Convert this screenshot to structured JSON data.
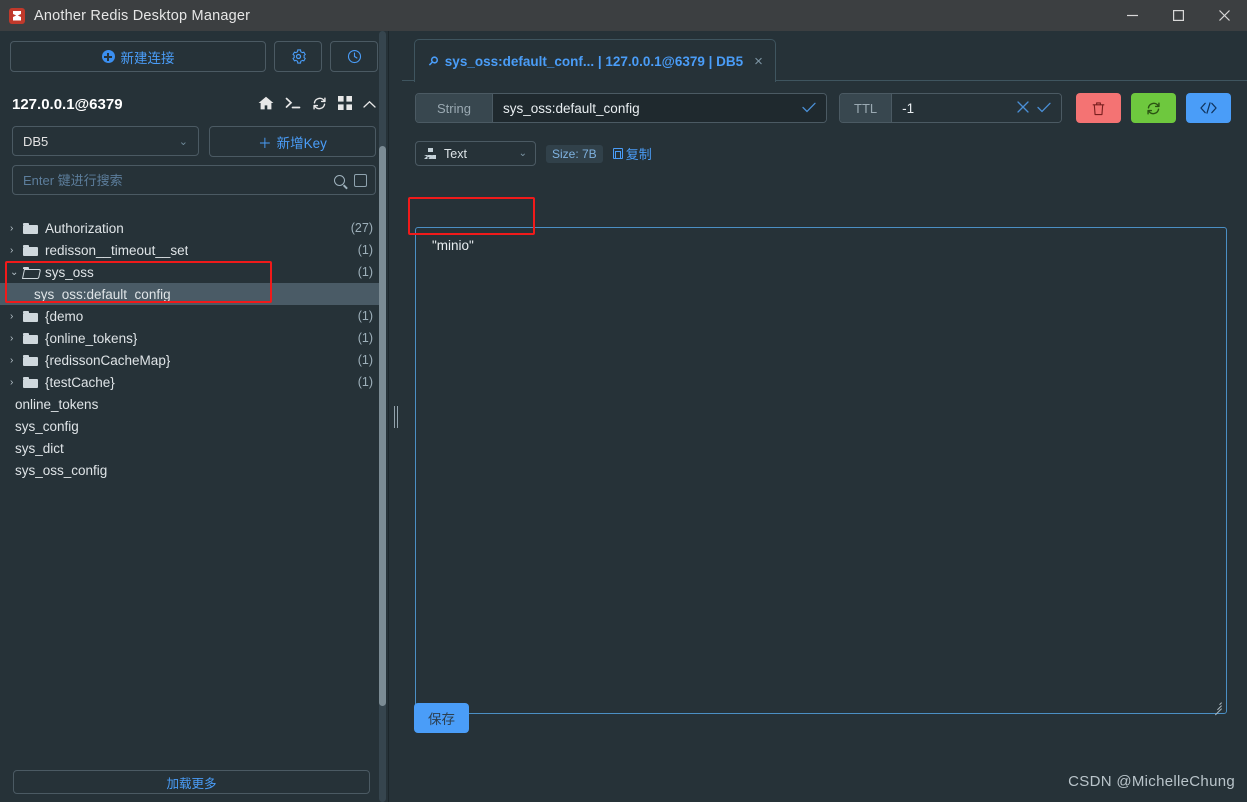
{
  "window": {
    "title": "Another Redis Desktop Manager",
    "app_icon": "redis-logo-icon",
    "minimize": "—",
    "maximize": "▫",
    "close": "✕"
  },
  "sidebar": {
    "new_connection_label": "新建连接",
    "settings_icon": "gear-icon",
    "history_icon": "clock-icon",
    "host": "127.0.0.1@6379",
    "host_icons": [
      "home-icon",
      "console-icon",
      "refresh-icon",
      "grid-icon",
      "collapse-icon"
    ],
    "db_selected": "DB5",
    "add_key_label": "新增Key",
    "search_placeholder": "Enter 键进行搜索",
    "search_value": "",
    "load_more_label": "加载更多",
    "tree": [
      {
        "label": "Authorization",
        "count": "(27)",
        "type": "folder",
        "arrow": "›",
        "selected": false
      },
      {
        "label": "redisson__timeout__set",
        "count": "(1)",
        "type": "folder",
        "arrow": "›",
        "selected": false
      },
      {
        "label": "sys_oss",
        "count": "(1)",
        "type": "folder-open",
        "arrow": "⌄",
        "selected": false
      },
      {
        "label": "sys_oss:default_config",
        "count": "",
        "type": "key",
        "arrow": "",
        "selected": true
      },
      {
        "label": "{demo",
        "count": "(1)",
        "type": "folder",
        "arrow": "›",
        "selected": false
      },
      {
        "label": "{online_tokens}",
        "count": "(1)",
        "type": "folder",
        "arrow": "›",
        "selected": false
      },
      {
        "label": "{redissonCacheMap}",
        "count": "(1)",
        "type": "folder",
        "arrow": "›",
        "selected": false
      },
      {
        "label": "{testCache}",
        "count": "(1)",
        "type": "folder",
        "arrow": "›",
        "selected": false
      },
      {
        "label": "online_tokens",
        "count": "",
        "type": "plain",
        "arrow": "",
        "selected": false
      },
      {
        "label": "sys_config",
        "count": "",
        "type": "plain",
        "arrow": "",
        "selected": false
      },
      {
        "label": "sys_dict",
        "count": "",
        "type": "plain",
        "arrow": "",
        "selected": false
      },
      {
        "label": "sys_oss_config",
        "count": "",
        "type": "plain",
        "arrow": "",
        "selected": false
      }
    ]
  },
  "main": {
    "tab": {
      "icon": "key-icon",
      "label": "sys_oss:default_conf... | 127.0.0.1@6379 | DB5",
      "close": "×"
    },
    "key_type_label": "String",
    "key_name": "sys_oss:default_config",
    "key_confirm_icon": "check-icon",
    "ttl_label": "TTL",
    "ttl_value": "-1",
    "ttl_cancel_icon": "x-icon",
    "ttl_confirm_icon": "check-icon",
    "actions": [
      {
        "name": "delete-key-button",
        "icon": "trash-icon",
        "glyph": "🗑",
        "color": "#f47373"
      },
      {
        "name": "refresh-key-button",
        "icon": "refresh-icon",
        "glyph": "⟳",
        "color": "#6ec83e"
      },
      {
        "name": "view-code-button",
        "icon": "code-icon",
        "glyph": "</>",
        "color": "#4a9df8"
      }
    ],
    "format_icon": "sitemap-icon",
    "format_selected": "Text",
    "size_badge": "Size: 7B",
    "copy_label": "复制",
    "copy_icon": "copy-icon",
    "value": "\"minio\"",
    "save_label": "保存"
  },
  "watermark": "CSDN @MichelleChung",
  "colors": {
    "background": "#263238",
    "titlebar": "#3c3f41",
    "accent_blue": "#4a9df8",
    "selection": "#4a5b66",
    "danger": "#f47373",
    "success": "#6ec83e",
    "annotation": "#f01a1a",
    "border": "#4b5a63"
  }
}
